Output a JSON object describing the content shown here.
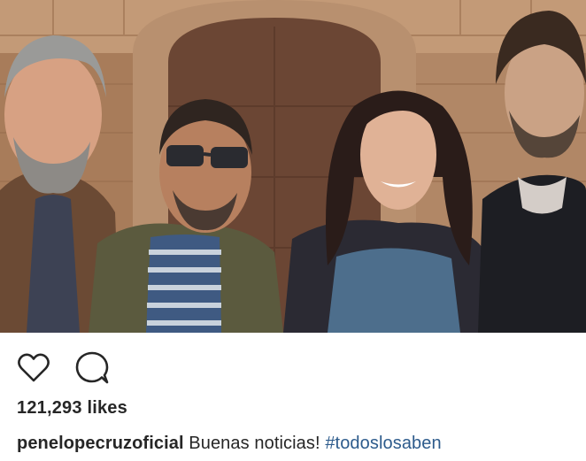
{
  "post": {
    "photo_icon": "group-photo",
    "likes_text": "121,293 likes",
    "caption": {
      "username": "penelopecruzoficial",
      "text": "Buenas noticias!",
      "hashtag": "#todoslosaben"
    }
  },
  "actions": [
    {
      "icon": "heart-icon"
    },
    {
      "icon": "comment-icon"
    }
  ],
  "colors": {
    "text": "#262626",
    "hashtag": "#2d5b8c",
    "icon_stroke": "#262626"
  }
}
